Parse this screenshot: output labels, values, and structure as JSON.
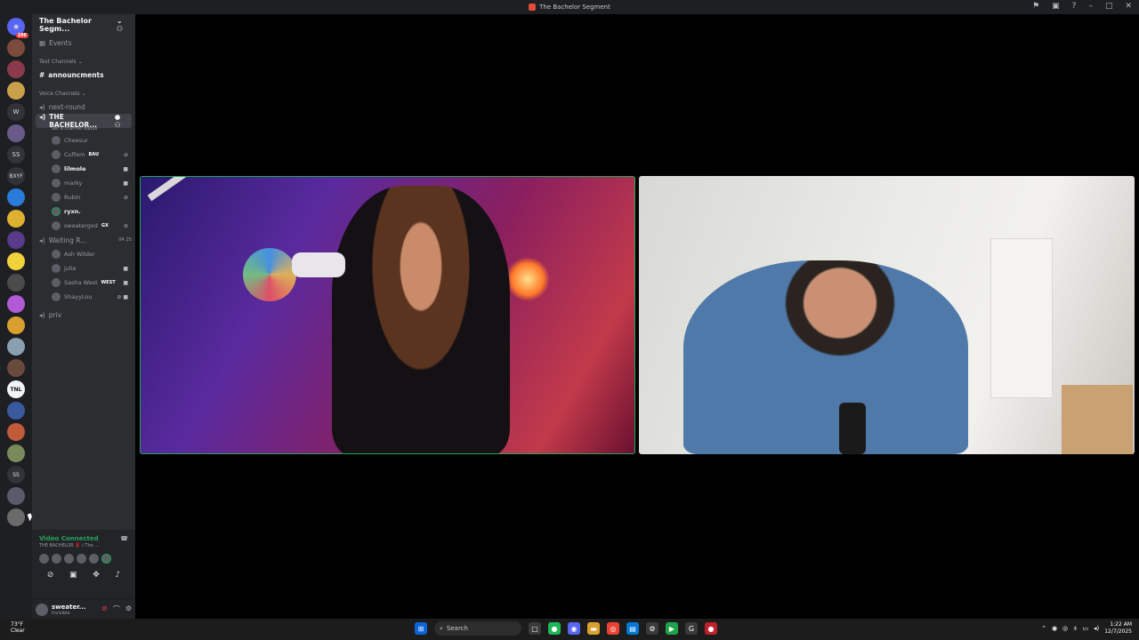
{
  "window": {
    "title": "The Bachelor Segment"
  },
  "guilds": {
    "badge": "106",
    "labels": {
      "w": "W",
      "ss1": "SS",
      "bxyf": "BXYF",
      "tnl": "TNL",
      "ss2": "SS"
    }
  },
  "sidebar": {
    "server_name": "The Bachelor Segm...",
    "events": "Events",
    "text_category": "Text Channels",
    "text_channels": [
      "announcments"
    ],
    "voice_category": "Voice Channels",
    "voice_channels": {
      "next_round": "next-round",
      "bachelor": "THE BACHELOR...",
      "bachelor_status": "Set a channel status",
      "waiting": "Waiting R...",
      "waiting_count_a": "04",
      "waiting_count_b": "25",
      "priv": "priv"
    },
    "bachelor_users": [
      {
        "name": "Cheesur",
        "tag": ""
      },
      {
        "name": "Cuffem",
        "tag": "BAU"
      },
      {
        "name": "lilmole",
        "tag": ""
      },
      {
        "name": "marky",
        "tag": ""
      },
      {
        "name": "Rubin",
        "tag": ""
      },
      {
        "name": "ryxn.",
        "tag": ""
      },
      {
        "name": "sweatergxd",
        "tag": "GX"
      }
    ],
    "waiting_users": [
      {
        "name": "Ash Wilder",
        "tag": ""
      },
      {
        "name": "julie",
        "tag": ""
      },
      {
        "name": "Sasha West",
        "tag": "WEST"
      },
      {
        "name": "ShayyLou",
        "tag": ""
      }
    ]
  },
  "voice_panel": {
    "status": "Video Connected",
    "channel": "THE BACHELOR 🌹 / The ..."
  },
  "user_panel": {
    "name": "sweater...",
    "status": "Invisible"
  },
  "taskbar": {
    "weather_temp": "73°F",
    "weather_desc": "Clear",
    "search": "Search",
    "time": "1:22 AM",
    "date": "12/7/2025"
  },
  "colors": {
    "accent_green": "#23a55a",
    "bg_sidebar": "#2b2d31",
    "bg_guilds": "#1e1f22"
  }
}
